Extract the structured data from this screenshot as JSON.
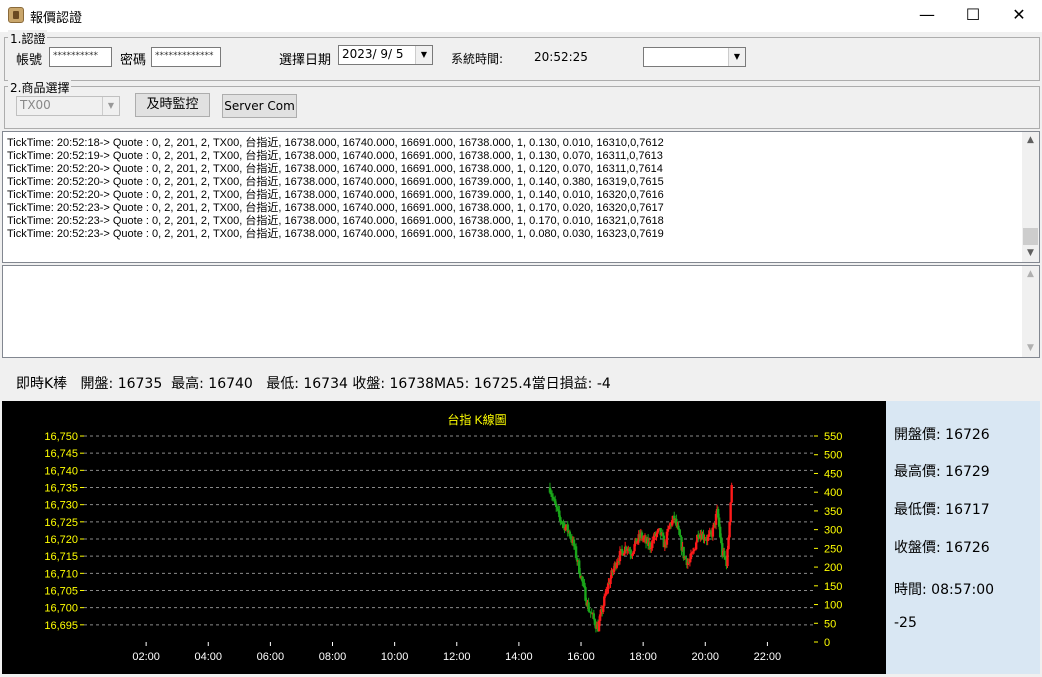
{
  "window": {
    "title": "報價認證"
  },
  "auth": {
    "group_title": "1.認證",
    "account_label": "帳號",
    "account_value": "**********",
    "password_label": "密碼",
    "password_value": "*************",
    "date_label": "選擇日期",
    "date_value": "2023/ 9/ 5",
    "sys_time_label": "系統時間:",
    "sys_time_value": "20:52:25"
  },
  "product": {
    "group_title": "2.商品選擇",
    "product_value": "TX00",
    "realtime_button": "及時監控",
    "server_button": "Server Com"
  },
  "log_lines": [
    "TickTime: 20:52:18-> Quote : 0, 2, 201, 2, TX00, 台指近, 16738.000, 16740.000, 16691.000, 16738.000, 1, 0.130, 0.010, 16310,0,7612",
    "TickTime: 20:52:19-> Quote : 0, 2, 201, 2, TX00, 台指近, 16738.000, 16740.000, 16691.000, 16738.000, 1, 0.130, 0.070, 16311,0,7613",
    "TickTime: 20:52:20-> Quote : 0, 2, 201, 2, TX00, 台指近, 16738.000, 16740.000, 16691.000, 16738.000, 1, 0.120, 0.070, 16311,0,7614",
    "TickTime: 20:52:20-> Quote : 0, 2, 201, 2, TX00, 台指近, 16738.000, 16740.000, 16691.000, 16739.000, 1, 0.140, 0.380, 16319,0,7615",
    "TickTime: 20:52:20-> Quote : 0, 2, 201, 2, TX00, 台指近, 16738.000, 16740.000, 16691.000, 16739.000, 1, 0.140, 0.010, 16320,0,7616",
    "TickTime: 20:52:23-> Quote : 0, 2, 201, 2, TX00, 台指近, 16738.000, 16740.000, 16691.000, 16738.000, 1, 0.170, 0.020, 16320,0,7617",
    "TickTime: 20:52:23-> Quote : 0, 2, 201, 2, TX00, 台指近, 16738.000, 16740.000, 16691.000, 16738.000, 1, 0.170, 0.010, 16321,0,7618",
    "TickTime: 20:52:23-> Quote : 0, 2, 201, 2, TX00, 台指近, 16738.000, 16740.000, 16691.000, 16738.000, 1, 0.080, 0.030, 16323,0,7619"
  ],
  "kbar_info": "即時K棒   開盤: 16735  最高: 16740   最低: 16734 收盤: 16738MA5: 16725.4當日損益: -4",
  "side_panel": {
    "open": "開盤價: 16726",
    "high": "最高價: 16729",
    "low": "最低價: 16717",
    "close": "收盤價: 16726",
    "time": "時間: 08:57:00",
    "pnl": "-25"
  },
  "colors": {
    "up": "#ff1a1a",
    "down": "#1aa61a",
    "axis_text": "#ffff00",
    "title": "#ffff00",
    "grid": "#8a8a8a"
  },
  "chart_data": {
    "type": "candlestick",
    "title": "台指 K線圖",
    "y_ticks": [
      "16,750",
      "16,745",
      "16,740",
      "16,735",
      "16,730",
      "16,725",
      "16,720",
      "16,715",
      "16,710",
      "16,705",
      "16,700",
      "16,695"
    ],
    "y2_ticks": [
      "550",
      "500",
      "450",
      "400",
      "350",
      "300",
      "250",
      "200",
      "150",
      "100",
      "50",
      "0"
    ],
    "x_ticks": [
      "02:00",
      "04:00",
      "06:00",
      "08:00",
      "10:00",
      "12:00",
      "14:00",
      "16:00",
      "18:00",
      "20:00",
      "22:00"
    ],
    "ylim": [
      16690,
      16750
    ],
    "y2lim": [
      0,
      550
    ],
    "xlim_hours": [
      0,
      23.5
    ],
    "candles_start_hour": 15.0,
    "candles_end_hour": 20.85,
    "close_path": [
      16735,
      16730,
      16726,
      16724,
      16722,
      16718,
      16712,
      16706,
      16700,
      16697,
      16694,
      16700,
      16706,
      16710,
      16714,
      16716,
      16718,
      16716,
      16719,
      16721,
      16719,
      16718,
      16721,
      16722,
      16718,
      16724,
      16726,
      16721,
      16715,
      16713,
      16716,
      16722,
      16721,
      16720,
      16722,
      16728,
      16716,
      16713,
      16736
    ]
  }
}
